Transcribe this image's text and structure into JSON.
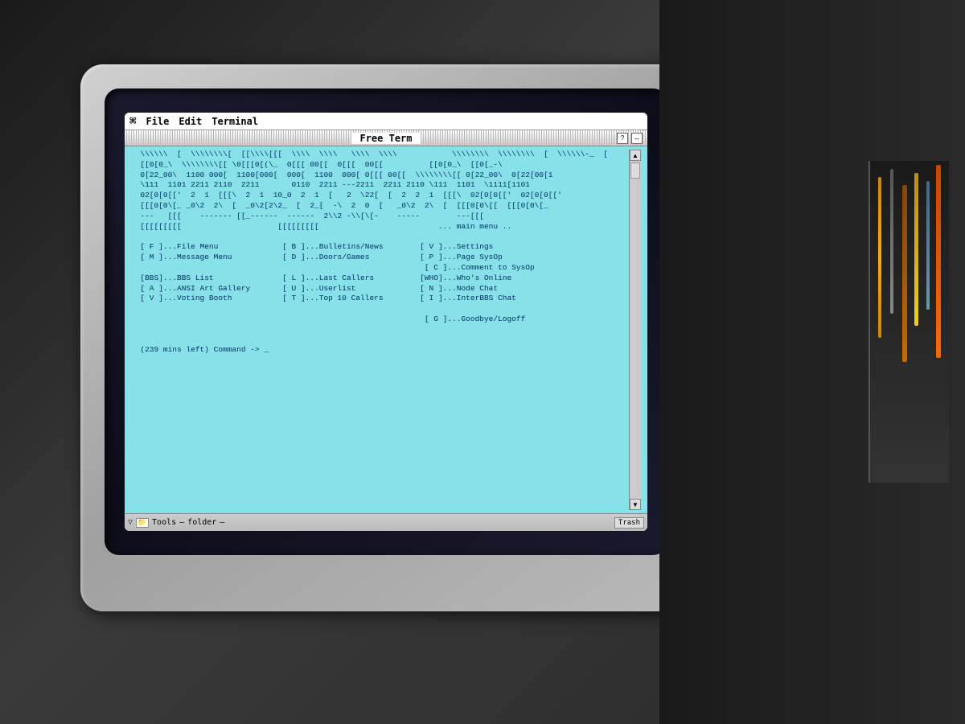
{
  "room": {
    "background_color": "#2a2a2a"
  },
  "mac": {
    "menu_bar": {
      "apple": "⌘",
      "items": [
        "File",
        "Edit",
        "Terminal"
      ]
    },
    "title_bar": {
      "title": "Free Term",
      "question_btn": "?",
      "resize_btn": "↔"
    },
    "terminal": {
      "ascii_art_lines": [
        "  \\\\\\\\\\\\  [  \\\\\\\\\\\\\\\\[  [[\\\\\\\\[[[  \\\\\\\\  \\\\\\\\   \\\\\\\\  \\\\\\\\            \\\\\\\\\\\\\\\\  \\\\\\\\\\\\\\\\  [  \\\\\\\\\\\\-_  [",
        "  [[0[0_\\  \\\\\\\\\\\\\\\\[[ \\0[[[0[(\\_  0[[[ 00[[  0[[[  00[[          [[0[0_\\  [[0[_-\\",
        "  0[22_00\\  1100 000[  1100[000[  000[  1100  000[ 0[[[ 00[[  \\\\\\\\\\\\\\\\[[ 0[22_00\\  0[22[00[1",
        "  \\111  1101 2211 2110  2211       0110  2211 ---2211  2211 2110 \\111  1101  \\1111[1101",
        "  02[0[0[['  2  1  [[[\\  2  1  10_0  2  1  [   2  \\22[  [  2  2  1  [[[\\  02[0[0[['  02[0[0[['",
        "  [[[0[0\\[_ _0\\2  2\\  [  _0\\2[2\\2_  [  2_[  -\\  2  0  [   _0\\2  2\\  [  [[[0[0\\[[  [[[0[0\\[_",
        "  ---   [[[    ------- [[_------  ------  2\\\\2 -\\\\[\\[-    -----        ---[[[",
        "  [[[[[[[[[                     [[[[[[[[[                          ... main menu ..",
        "",
        "  [ F ]...File Menu              [ B ]...Bulletins/News        [ V ]...Settings",
        "  [ M ]...Message Menu           [ D ]...Doors/Games           [ P ]...Page SysOp",
        "                                                                [ C ]...Comment to SysOp",
        "  [BBS]...BBS List               [ L ]...Last Callers          [WHO]...Who's Online",
        "  [ A ]...ANSI Art Gallery       [ U ]...Userlist              [ N ]...Node Chat",
        "  [ V ]...Voting Booth           [ T ]...Top 10 Callers        [ I ]...InterBBS Chat",
        "",
        "                                                                [ G ]...Goodbye/Logoff",
        "",
        "",
        "  (239 mins left) Command -> _"
      ]
    },
    "finder_bar": {
      "triangle": "▽",
      "folder_label": "Tools",
      "dash1": "–",
      "folder_name": "folder",
      "dash2": "–",
      "trash_label": "Trash"
    }
  }
}
